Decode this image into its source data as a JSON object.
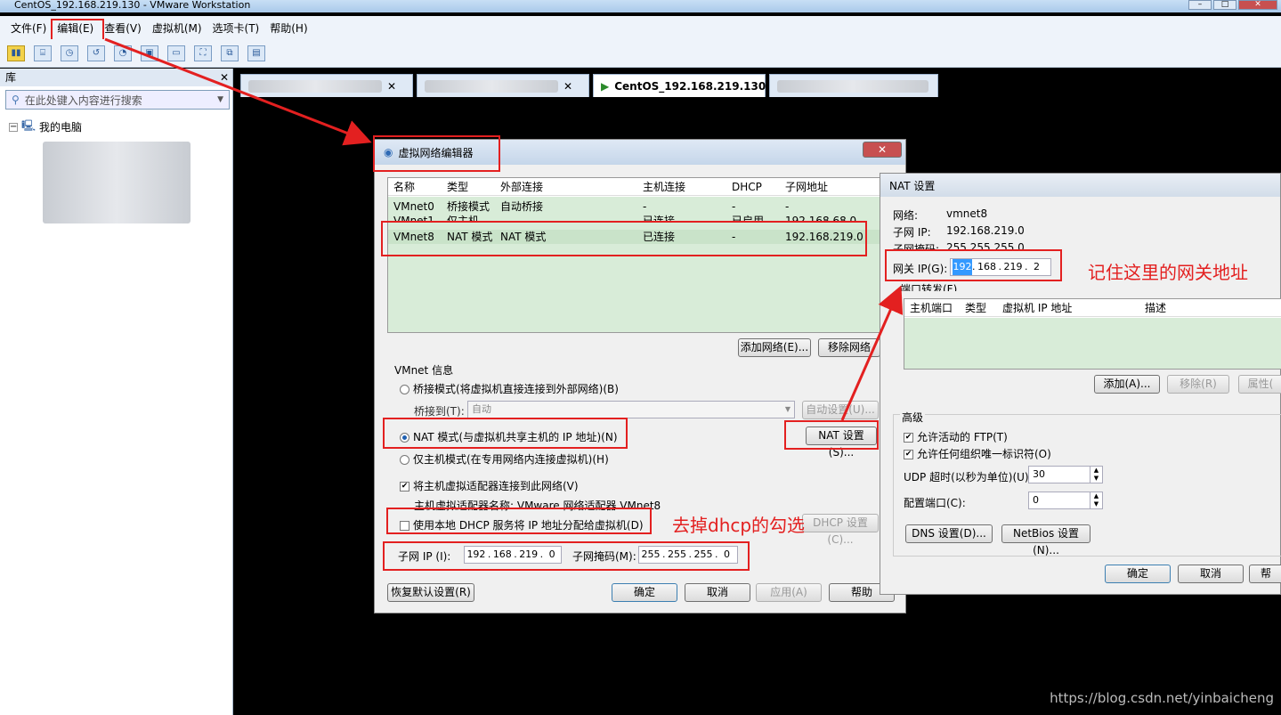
{
  "window": {
    "title": "CentOS_192.168.219.130 - VMware Workstation"
  },
  "menu": [
    "文件(F)",
    "编辑(E)",
    "查看(V)",
    "虚拟机(M)",
    "选项卡(T)",
    "帮助(H)"
  ],
  "sidebar": {
    "title": "库",
    "search_placeholder": "在此处键入内容进行搜索",
    "tree_root": "我的电脑"
  },
  "tabs": {
    "active_label": "CentOS_192.168.219.130"
  },
  "vne": {
    "title": "虚拟网络编辑器",
    "columns": [
      "名称",
      "类型",
      "外部连接",
      "主机连接",
      "DHCP",
      "子网地址"
    ],
    "rows": [
      [
        "VMnet0",
        "桥接模式",
        "自动桥接",
        "-",
        "-",
        "-"
      ],
      [
        "VMnet1",
        "仅主机",
        "-",
        "已连接",
        "已启用",
        "192.168.68.0"
      ],
      [
        "VMnet8",
        "NAT 模式",
        "NAT 模式",
        "已连接",
        "-",
        "192.168.219.0"
      ]
    ],
    "add_network": "添加网络(E)...",
    "remove_network": "移除网络",
    "vmnet_info": "VMnet 信息",
    "bridged": "桥接模式(将虚拟机直接连接到外部网络)(B)",
    "bridge_to_label": "桥接到(T):",
    "bridge_to_value": "自动",
    "auto_settings": "自动设置(U)...",
    "nat": "NAT 模式(与虚拟机共享主机的 IP 地址)(N)",
    "nat_settings": "NAT 设置(S)...",
    "host_only": "仅主机模式(在专用网络内连接虚拟机)(H)",
    "connect_adapter": "将主机虚拟适配器连接到此网络(V)",
    "adapter_name": "主机虚拟适配器名称: VMware 网络适配器 VMnet8",
    "dhcp": "使用本地 DHCP 服务将 IP 地址分配给虚拟机(D)",
    "dhcp_settings": "DHCP 设置(C)...",
    "subnet_ip_label": "子网 IP (I):",
    "subnet_ip": [
      "192",
      "168",
      "219",
      "0"
    ],
    "subnet_mask_label": "子网掩码(M):",
    "subnet_mask": [
      "255",
      "255",
      "255",
      "0"
    ],
    "restore": "恢复默认设置(R)",
    "ok": "确定",
    "cancel": "取消",
    "apply": "应用(A)",
    "help": "帮助"
  },
  "nat": {
    "title": "NAT 设置",
    "network_label": "网络:",
    "network_value": "vmnet8",
    "subnet_ip_label": "子网 IP:",
    "subnet_ip_value": "192.168.219.0",
    "subnet_mask_label": "子网掩码:",
    "subnet_mask_value": "255.255.255.0",
    "gateway_label": "网关 IP(G):",
    "gateway": [
      "192",
      "168",
      "219",
      "2"
    ],
    "port_forward": "端口转发(F)",
    "pf_columns": [
      "主机端口",
      "类型",
      "虚拟机 IP 地址",
      "描述"
    ],
    "add": "添加(A)...",
    "remove": "移除(R)",
    "properties": "属性(",
    "advanced": "高级",
    "allow_ftp": "允许活动的 FTP(T)",
    "allow_oui": "允许任何组织唯一标识符(O)",
    "udp_timeout_label": "UDP 超时(以秒为单位)(U):",
    "udp_timeout": "30",
    "config_port_label": "配置端口(C):",
    "config_port": "0",
    "dns": "DNS 设置(D)...",
    "netbios": "NetBios 设置(N)...",
    "ok": "确定",
    "cancel": "取消",
    "help": "帮"
  },
  "annotations": {
    "remember_gateway": "记住这里的网关地址",
    "remove_dhcp": "去掉dhcp的勾选"
  },
  "watermark": "https://blog.csdn.net/yinbaicheng",
  "colors": {
    "annotation": "#e32020",
    "list_green": "#d8ecd8"
  }
}
